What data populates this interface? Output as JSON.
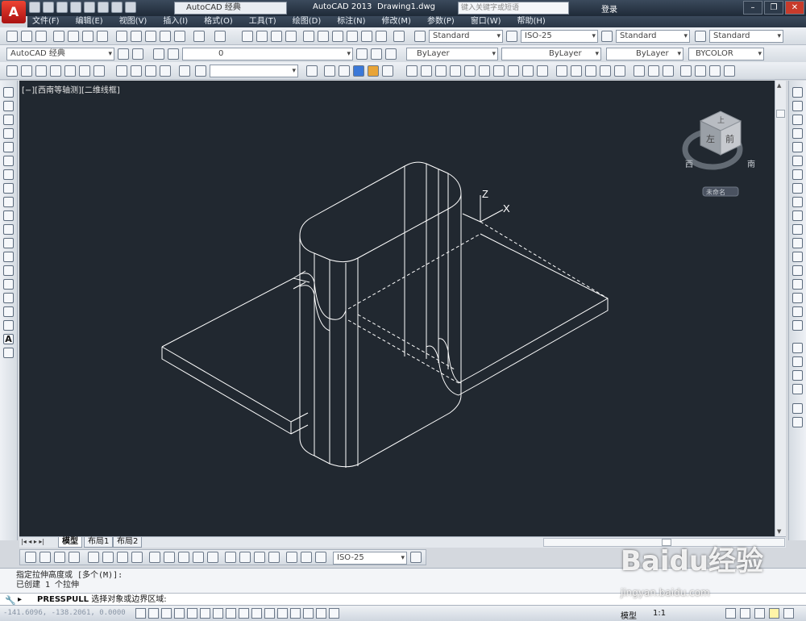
{
  "titlebar": {
    "app_button": "A",
    "workspace": "AutoCAD 经典",
    "app_title": "AutoCAD 2013",
    "file_name": "Drawing1.dwg",
    "search_placeholder": "键入关键字或短语",
    "login_label": "登录"
  },
  "menu": [
    "文件(F)",
    "编辑(E)",
    "视图(V)",
    "插入(I)",
    "格式(O)",
    "工具(T)",
    "绘图(D)",
    "标注(N)",
    "修改(M)",
    "参数(P)",
    "窗口(W)",
    "帮助(H)"
  ],
  "styles": {
    "text_style": "Standard",
    "dim_style": "ISO-25",
    "table_style": "Standard",
    "multileader_style": "Standard"
  },
  "layers": {
    "workspace": "AutoCAD 经典",
    "current_layer": "0",
    "color": "ByLayer",
    "linetype": "ByLayer",
    "lineweight": "ByLayer",
    "plot_style": "BYCOLOR"
  },
  "viewport": {
    "label": "[−][西南等轴测][二维线框]",
    "viewcube_top": "上",
    "viewcube_left": "左",
    "viewcube_front": "前",
    "compass_west": "西",
    "compass_south": "南",
    "named_view": "未命名",
    "ucs_z": "Z",
    "ucs_x": "X",
    "background_color": "#212830",
    "line_color": "#ffffff"
  },
  "tabs": [
    "模型",
    "布局1",
    "布局2"
  ],
  "dim_toolbar": {
    "dim_style": "ISO-25"
  },
  "command": {
    "history_1": "指定拉伸高度或 [多个(M)]:",
    "history_2": "已创建 1 个拉伸",
    "prompt_command": "PRESSPULL",
    "prompt_text": "选择对象或边界区域:"
  },
  "status": {
    "coords": "-141.6096, -138.2061, 0.0000",
    "model_label": "模型",
    "annotation_scale": "1:1"
  },
  "watermark": {
    "logo": "Baidu经验",
    "url": "jingyan.baidu.com"
  }
}
